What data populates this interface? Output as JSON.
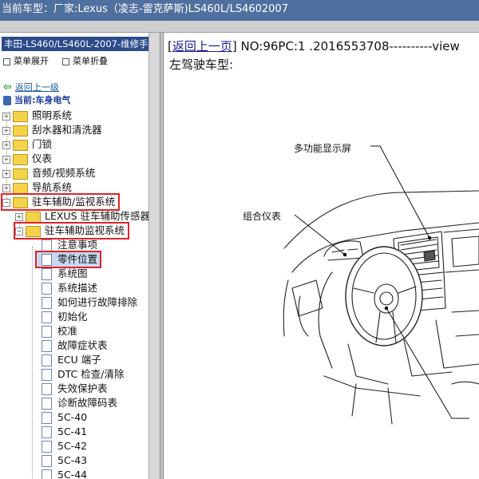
{
  "header": {
    "prefix": "当前车型：",
    "model": "厂家:Lexus（凌志-雷克萨斯)LS460L/LS4602007"
  },
  "sidebar": {
    "title": "丰田-LS460/LS460L-2007-维修手册",
    "expand_all": "菜单展开",
    "collapse_all": "菜单折叠",
    "back": "返回上一级",
    "current": "当前:车身电气",
    "folders": [
      "照明系统",
      "刮水器和清洗器",
      "门锁",
      "仪表",
      "音频/视频系统",
      "导航系统",
      "驻车辅助/监视系统"
    ],
    "sub_folders": [
      "LEXUS 驻车辅助传感器",
      "驻车辅助监视系统"
    ],
    "docs": [
      "注意事项",
      "零件位置",
      "系统图",
      "系统描述",
      "如何进行故障排除",
      "初始化",
      "校准",
      "故障症状表",
      "ECU 端子",
      "DTC 检查/清除",
      "失效保护表",
      "诊断故障码表",
      "5C-40",
      "5C-41",
      "5C-42",
      "5C-43",
      "5C-44"
    ]
  },
  "content": {
    "back_link": "返回上一页",
    "doc_info": "NO:96PC:1 .2016553708----------view",
    "bracket_open": "[",
    "bracket_close": "]",
    "subtitle": "左驾驶车型:",
    "callouts": {
      "multi_display": "多功能显示屏",
      "meter": "组合仪表"
    }
  }
}
